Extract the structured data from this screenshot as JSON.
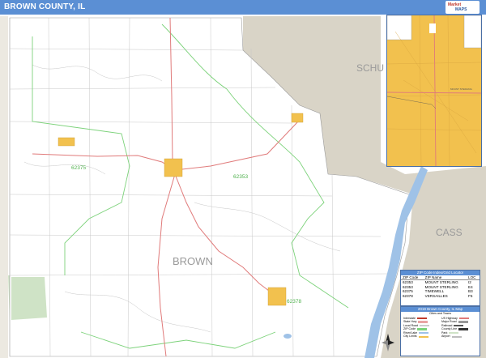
{
  "header": {
    "title": "BROWN COUNTY, IL",
    "logo_text": [
      "Market",
      "MAPS"
    ]
  },
  "map": {
    "county_label": "BROWN",
    "neighbor_labels": [
      "SCHU",
      "CASS"
    ],
    "zip_labels": [
      "62375",
      "62353",
      "62378"
    ],
    "colors": {
      "land": "#ffffff",
      "neighbor": "#d9d4c7",
      "town": "#f2c14e",
      "water": "#9fc2e7",
      "zip_boundary": "#7cd27a",
      "highway": "#e07a7a",
      "road": "#b0b0b0",
      "header": "#5b8fd4",
      "park": "#cfe3c6"
    }
  },
  "inset": {
    "label": "MOUNT STERLING"
  },
  "zip_legend": {
    "title": "ZIP Code Index/Grid Locator",
    "columns": [
      "ZIP Code",
      "ZIP Name",
      "LOC"
    ],
    "rows": [
      [
        "62353",
        "MOUNT STERLING",
        "I2"
      ],
      [
        "62353",
        "MOUNT STERLING",
        "E4"
      ],
      [
        "62375",
        "TIMEWELL",
        "B3"
      ],
      [
        "62378",
        "VERSAILLES",
        "F5"
      ]
    ]
  },
  "map_key": {
    "title": "2019 Brown County, IL Map",
    "subtitle": "Cities and Towns",
    "items": [
      {
        "label": "Interstate",
        "color": "#c0392b"
      },
      {
        "label": "US Highway",
        "color": "#e07a7a"
      },
      {
        "label": "State Hwy",
        "color": "#e9a3a3"
      },
      {
        "label": "Major Road",
        "color": "#999999"
      },
      {
        "label": "Local Road",
        "color": "#cccccc"
      },
      {
        "label": "Railroad",
        "color": "#555555"
      },
      {
        "label": "ZIP Code",
        "color": "#7cd27a"
      },
      {
        "label": "County Line",
        "color": "#333333"
      },
      {
        "label": "River/Lake",
        "color": "#9fc2e7"
      },
      {
        "label": "Park",
        "color": "#cfe3c6"
      },
      {
        "label": "City Limits",
        "color": "#f2c14e"
      },
      {
        "label": "Airport",
        "color": "#bdbdbd"
      }
    ]
  }
}
